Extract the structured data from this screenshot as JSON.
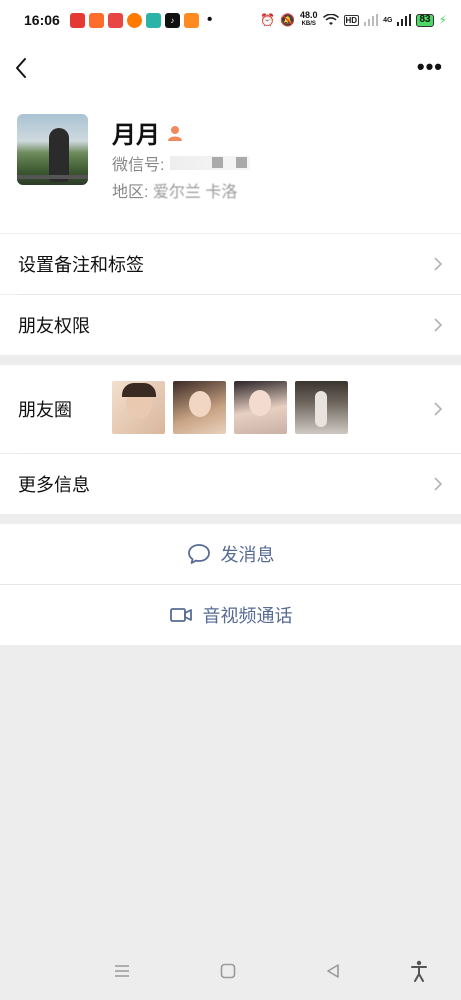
{
  "status_bar": {
    "time": "16:06",
    "speed_value": "48.0",
    "speed_unit": "KB/S",
    "hd_label": "HD",
    "signal_label": "4G",
    "battery": "83"
  },
  "profile": {
    "name": "月月",
    "wechat_id_label": "微信号:",
    "region_label": "地区:",
    "region_value": "爱尔兰  卡洛"
  },
  "menu": {
    "remark_label": "设置备注和标签",
    "permissions_label": "朋友权限",
    "moments_label": "朋友圈",
    "more_info_label": "更多信息"
  },
  "actions": {
    "message_label": "发消息",
    "call_label": "音视频通话"
  },
  "colors": {
    "accent": "#576b95",
    "background": "#ededed",
    "gender_icon": "#f08a5d"
  }
}
